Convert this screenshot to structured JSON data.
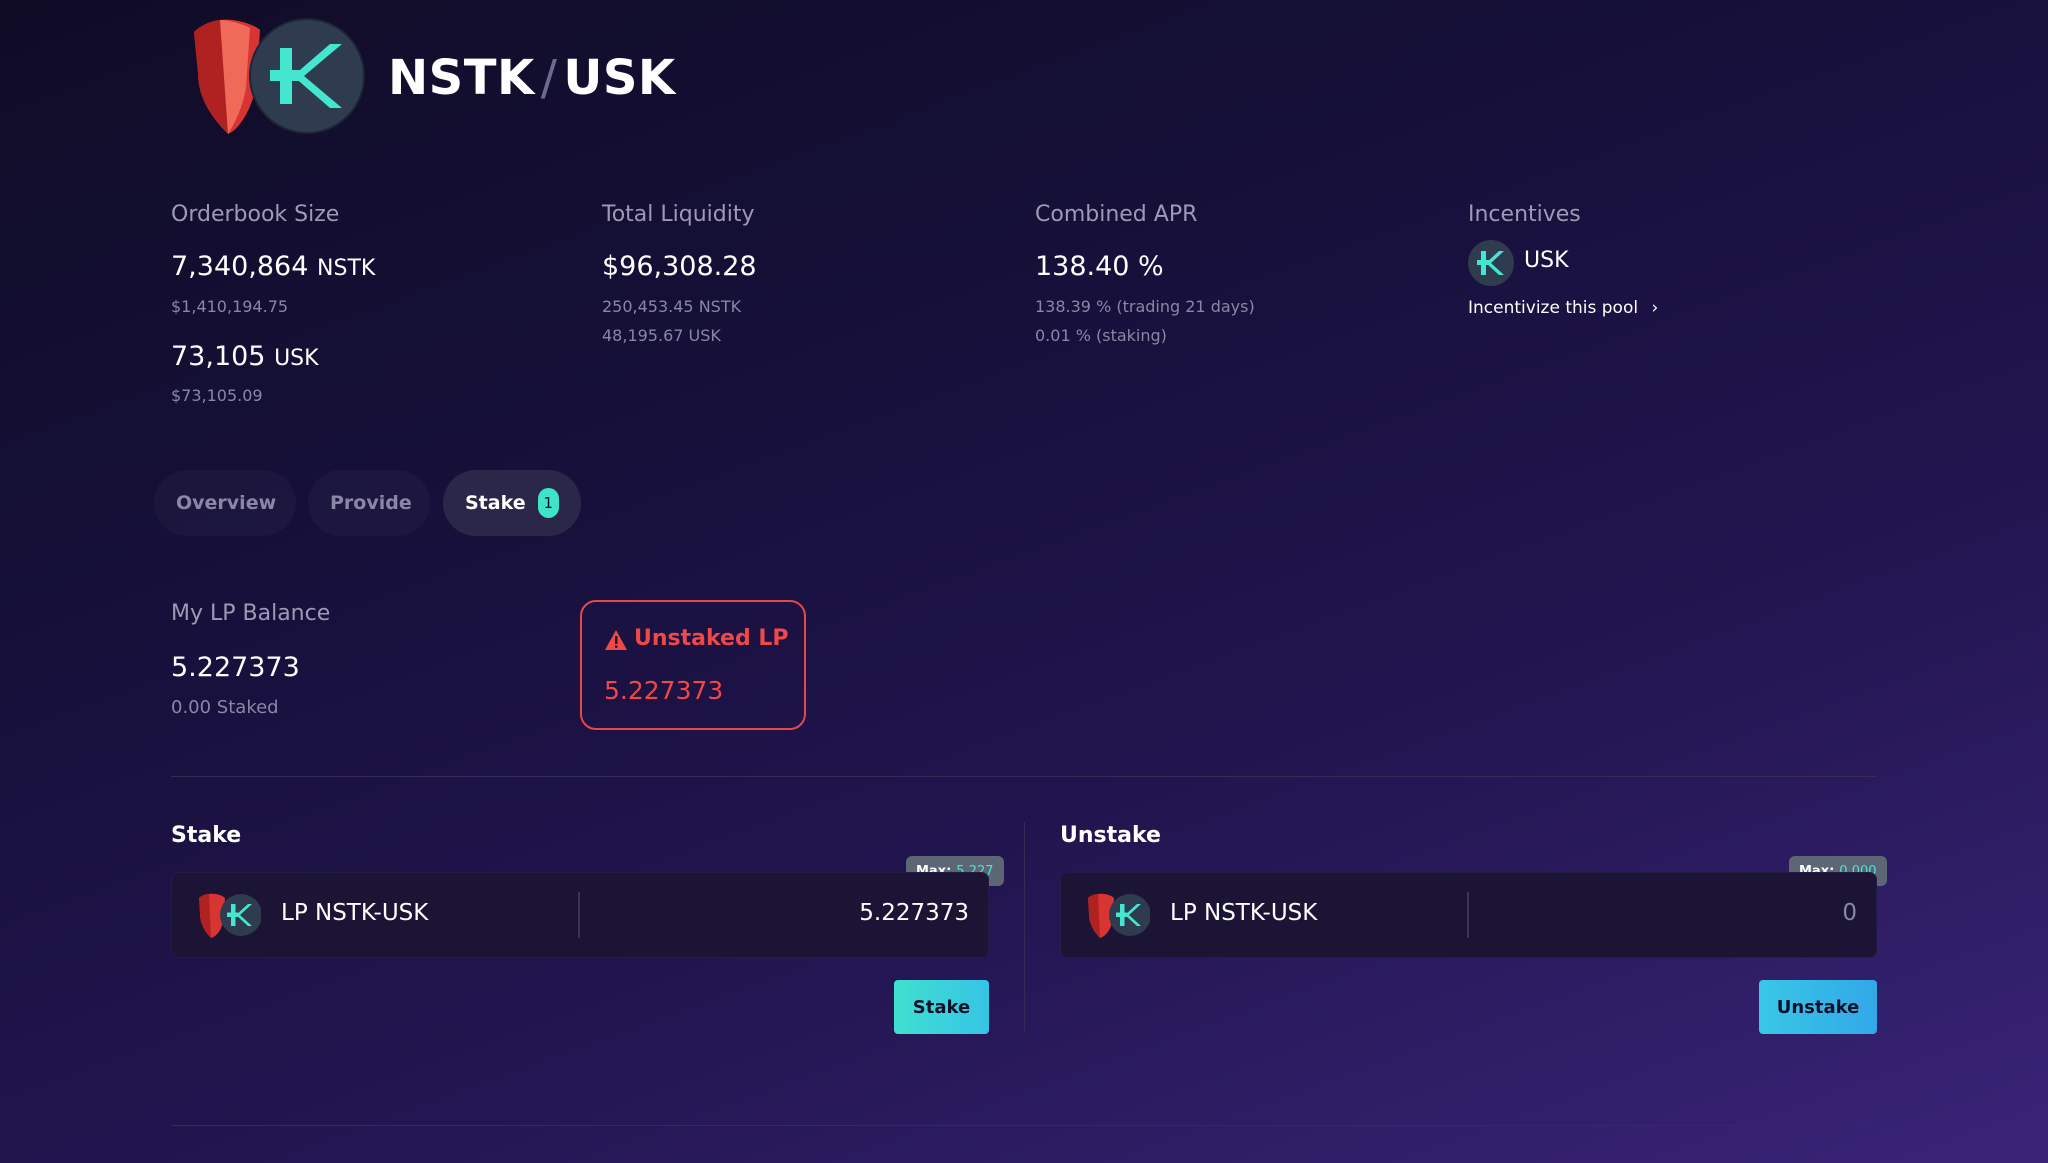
{
  "pair": {
    "base": "NSTK",
    "slash": "/",
    "quote": "USK"
  },
  "stats": {
    "orderbook": {
      "label": "Orderbook Size",
      "nstk_amount": "7,340,864",
      "nstk_unit": "NSTK",
      "nstk_usd": "$1,410,194.75",
      "usk_amount": "73,105",
      "usk_unit": "USK",
      "usk_usd": "$73,105.09"
    },
    "liquidity": {
      "label": "Total Liquidity",
      "total": "$96,308.28",
      "nstk": "250,453.45 NSTK",
      "usk": "48,195.67 USK"
    },
    "apr": {
      "label": "Combined APR",
      "value": "138.40 %",
      "trading": "138.39 % (trading 21 days)",
      "staking": "0.01 % (staking)"
    },
    "incentives": {
      "label": "Incentives",
      "token": "USK",
      "link": "Incentivize this pool",
      "chevron": "›"
    }
  },
  "tabs": [
    {
      "label": "Overview"
    },
    {
      "label": "Provide"
    },
    {
      "label": "Stake",
      "badge": "1"
    }
  ],
  "lp": {
    "label": "My LP Balance",
    "balance": "5.227373",
    "staked": "0.00 Staked",
    "warning_label": "Unstaked LP",
    "warning_value": "5.227373"
  },
  "stake_panel": {
    "title": "Stake",
    "token": "LP NSTK-USK",
    "amount": "5.227373",
    "max_label": "Max:",
    "max_value": "5.227",
    "button": "Stake"
  },
  "unstake_panel": {
    "title": "Unstake",
    "token": "LP NSTK-USK",
    "amount": "0",
    "max_label": "Max:",
    "max_value": "0.000",
    "button": "Unstake"
  },
  "colors": {
    "accent": "#40e0d0",
    "warning": "#f04747",
    "background": "#16103a"
  },
  "icons": [
    "shield-token-icon",
    "kujira-k-icon",
    "warning-triangle-icon",
    "chevron-right-icon"
  ]
}
